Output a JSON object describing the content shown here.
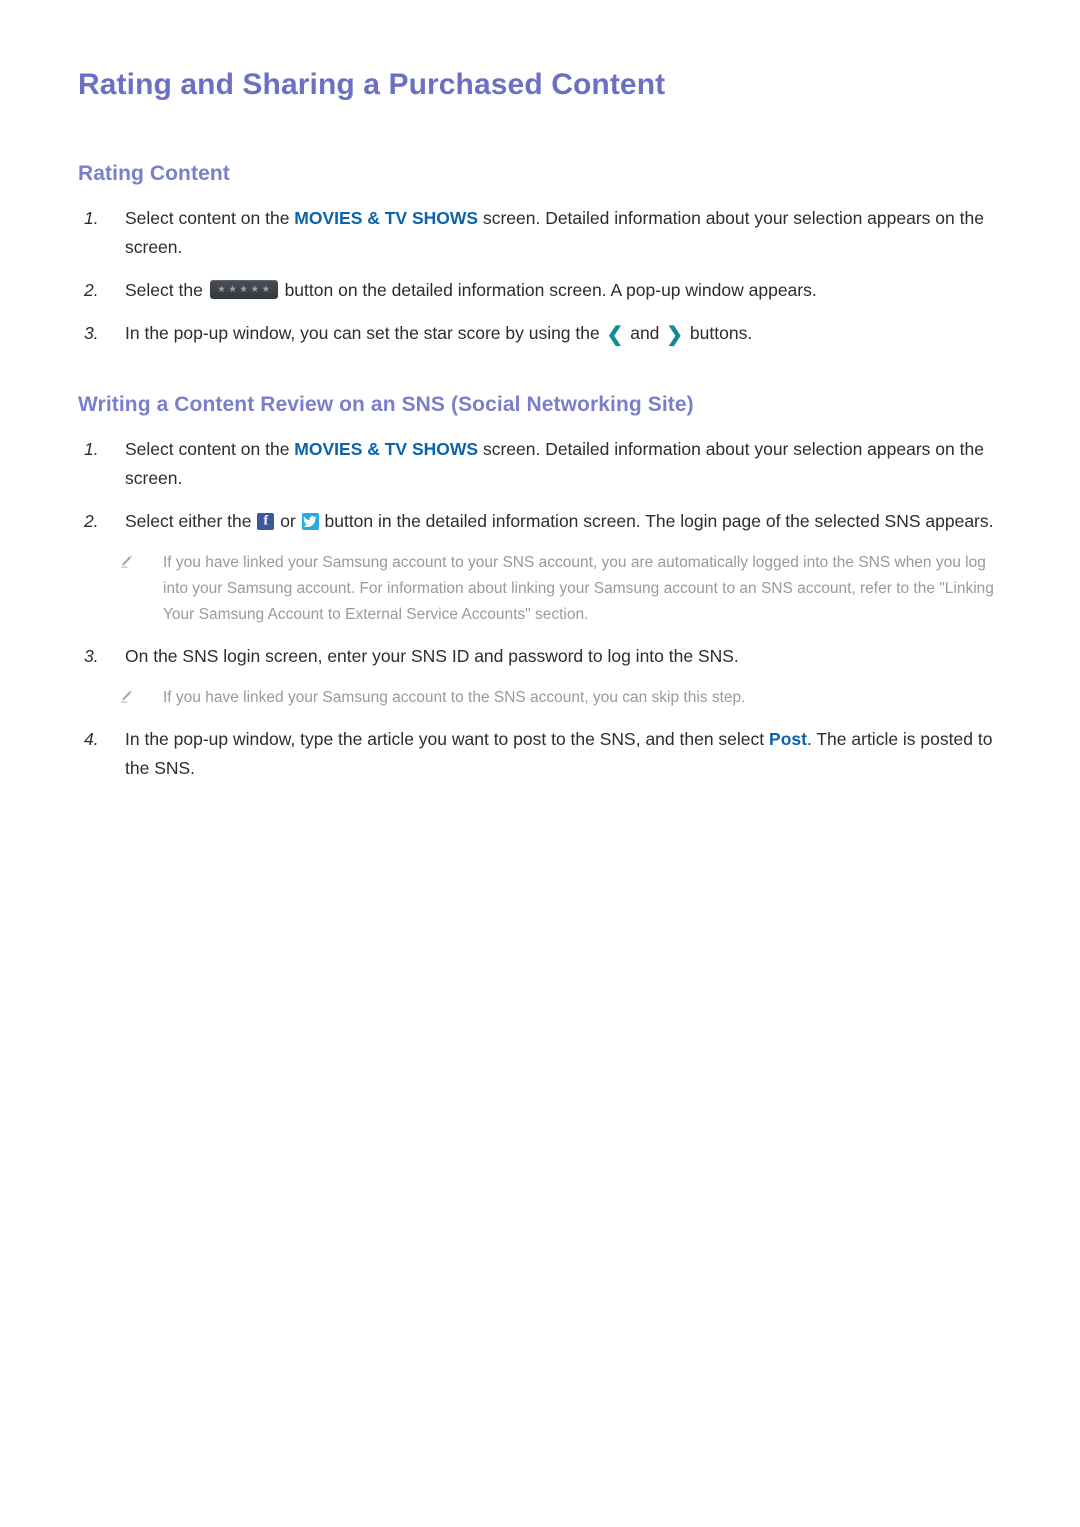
{
  "document": {
    "title": "Rating and Sharing a Purchased Content"
  },
  "colors": {
    "title_purple": "#6b70c2",
    "section_purple": "#7a7fcb",
    "accent_blue": "#0b63ac",
    "chevron_teal": "#12899e",
    "facebook_blue": "#3a5a9b",
    "twitter_blue": "#2aa9e0",
    "body_text": "#2d2d2d",
    "note_text": "#9a9a9a"
  },
  "sections": [
    {
      "heading": "Rating Content",
      "steps": [
        {
          "number": "1.",
          "parts": [
            {
              "type": "text",
              "value": "Select content on the "
            },
            {
              "type": "accent",
              "value": "MOVIES & TV SHOWS"
            },
            {
              "type": "text",
              "value": " screen. Detailed information about your selection appears on the screen."
            }
          ]
        },
        {
          "number": "2.",
          "parts": [
            {
              "type": "text",
              "value": "Select the "
            },
            {
              "type": "icon",
              "value": "star-rating-button"
            },
            {
              "type": "text",
              "value": " button on the detailed information screen. A pop-up window appears."
            }
          ]
        },
        {
          "number": "3.",
          "parts": [
            {
              "type": "text",
              "value": "In the pop-up window, you can set the star score by using the "
            },
            {
              "type": "icon",
              "value": "chevron-left-icon"
            },
            {
              "type": "text",
              "value": " and "
            },
            {
              "type": "icon",
              "value": "chevron-right-icon"
            },
            {
              "type": "text",
              "value": " buttons."
            }
          ]
        }
      ]
    },
    {
      "heading": "Writing a Content Review on an SNS (Social Networking Site)",
      "steps": [
        {
          "number": "1.",
          "parts": [
            {
              "type": "text",
              "value": "Select content on the "
            },
            {
              "type": "accent",
              "value": "MOVIES & TV SHOWS"
            },
            {
              "type": "text",
              "value": " screen. Detailed information about your selection appears on the screen."
            }
          ]
        },
        {
          "number": "2.",
          "parts": [
            {
              "type": "text",
              "value": "Select either the "
            },
            {
              "type": "icon",
              "value": "facebook-icon"
            },
            {
              "type": "text",
              "value": " or "
            },
            {
              "type": "icon",
              "value": "twitter-icon"
            },
            {
              "type": "text",
              "value": " button in the detailed information screen. The login page of the selected SNS appears."
            }
          ]
        },
        {
          "number": "3.",
          "parts": [
            {
              "type": "text",
              "value": "On the SNS login screen, enter your SNS ID and password to log into the SNS."
            }
          ]
        },
        {
          "number": "4.",
          "parts": [
            {
              "type": "text",
              "value": "In the pop-up window, type the article you want to post to the SNS, and then select "
            },
            {
              "type": "accent",
              "value": "Post"
            },
            {
              "type": "text",
              "value": ". The article is posted to the SNS."
            }
          ]
        }
      ]
    }
  ],
  "notes": {
    "note_1": "If you have linked your Samsung account to your SNS account, you are automatically logged into the SNS when you log into your Samsung account. For information about linking your Samsung account to an SNS account, refer to the \"Linking Your Samsung Account to External Service Accounts\" section.",
    "note_2": "If you have linked your Samsung account to the SNS account, you can skip this step."
  },
  "icons": {
    "pencil": "pencil-icon",
    "stars": "★★★★★",
    "chevron_left": "❮",
    "chevron_right": "❯",
    "facebook_glyph": "f"
  }
}
